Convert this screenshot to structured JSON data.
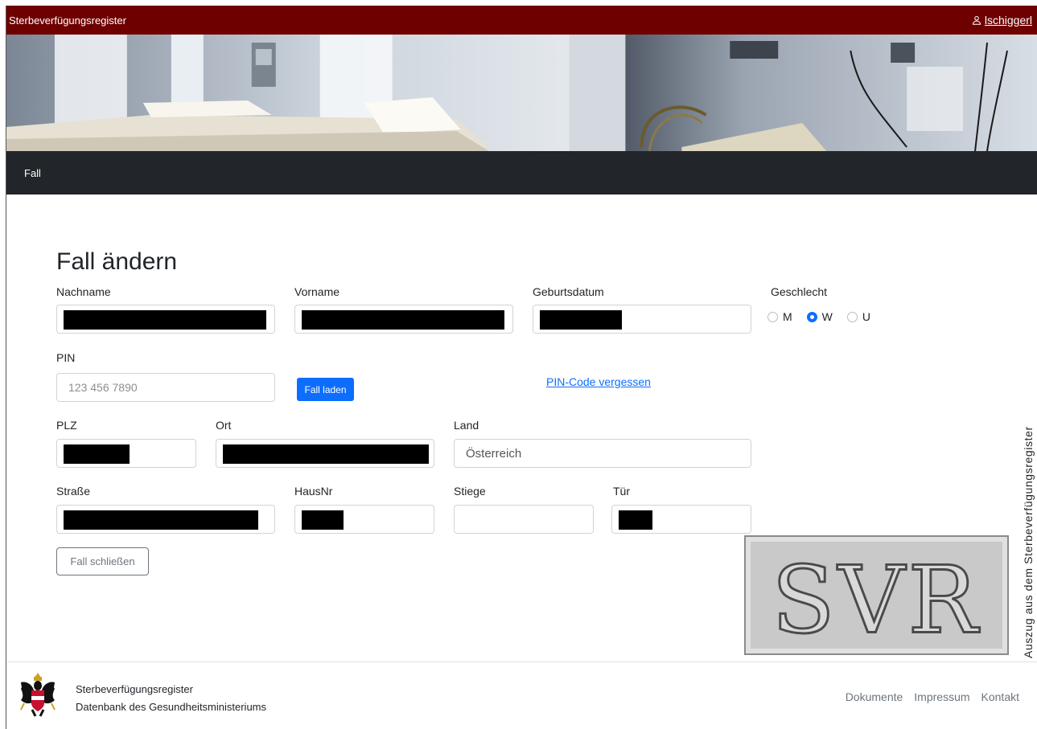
{
  "topbar": {
    "brand": "Sterbeverfügungsregister",
    "user_name": "lschiggerl",
    "user_icon": "user-icon"
  },
  "nav": {
    "items": [
      {
        "label": "Fall"
      }
    ]
  },
  "form": {
    "title": "Fall ändern",
    "nachname_label": "Nachname",
    "vorname_label": "Vorname",
    "geburtsdatum_label": "Geburtsdatum",
    "geschlecht_label": "Geschlecht",
    "geschlecht_options": [
      "M",
      "W",
      "U"
    ],
    "geschlecht_selected": "W",
    "pin_label": "PIN",
    "pin_placeholder": "123 456 7890",
    "load_button": "Fall laden",
    "forgot_link": "PIN-Code vergessen",
    "plz_label": "PLZ",
    "ort_label": "Ort",
    "land_label": "Land",
    "land_value": "Österreich",
    "strasse_label": "Straße",
    "hausnr_label": "HausNr",
    "stiege_label": "Stiege",
    "tuer_label": "Tür",
    "close_button": "Fall schließen"
  },
  "watermark": {
    "logo_text": "SVR",
    "side_text": "Auszug aus dem Sterbeverfügungsregister"
  },
  "footer": {
    "line1": "Sterbeverfügungsregister",
    "line2": "Datenbank des Gesundheitsministeriums",
    "links": [
      "Dokumente",
      "Impressum",
      "Kontakt"
    ]
  },
  "colors": {
    "topbar": "#6e0000",
    "nav": "#22262a",
    "primary": "#0d6efd"
  }
}
